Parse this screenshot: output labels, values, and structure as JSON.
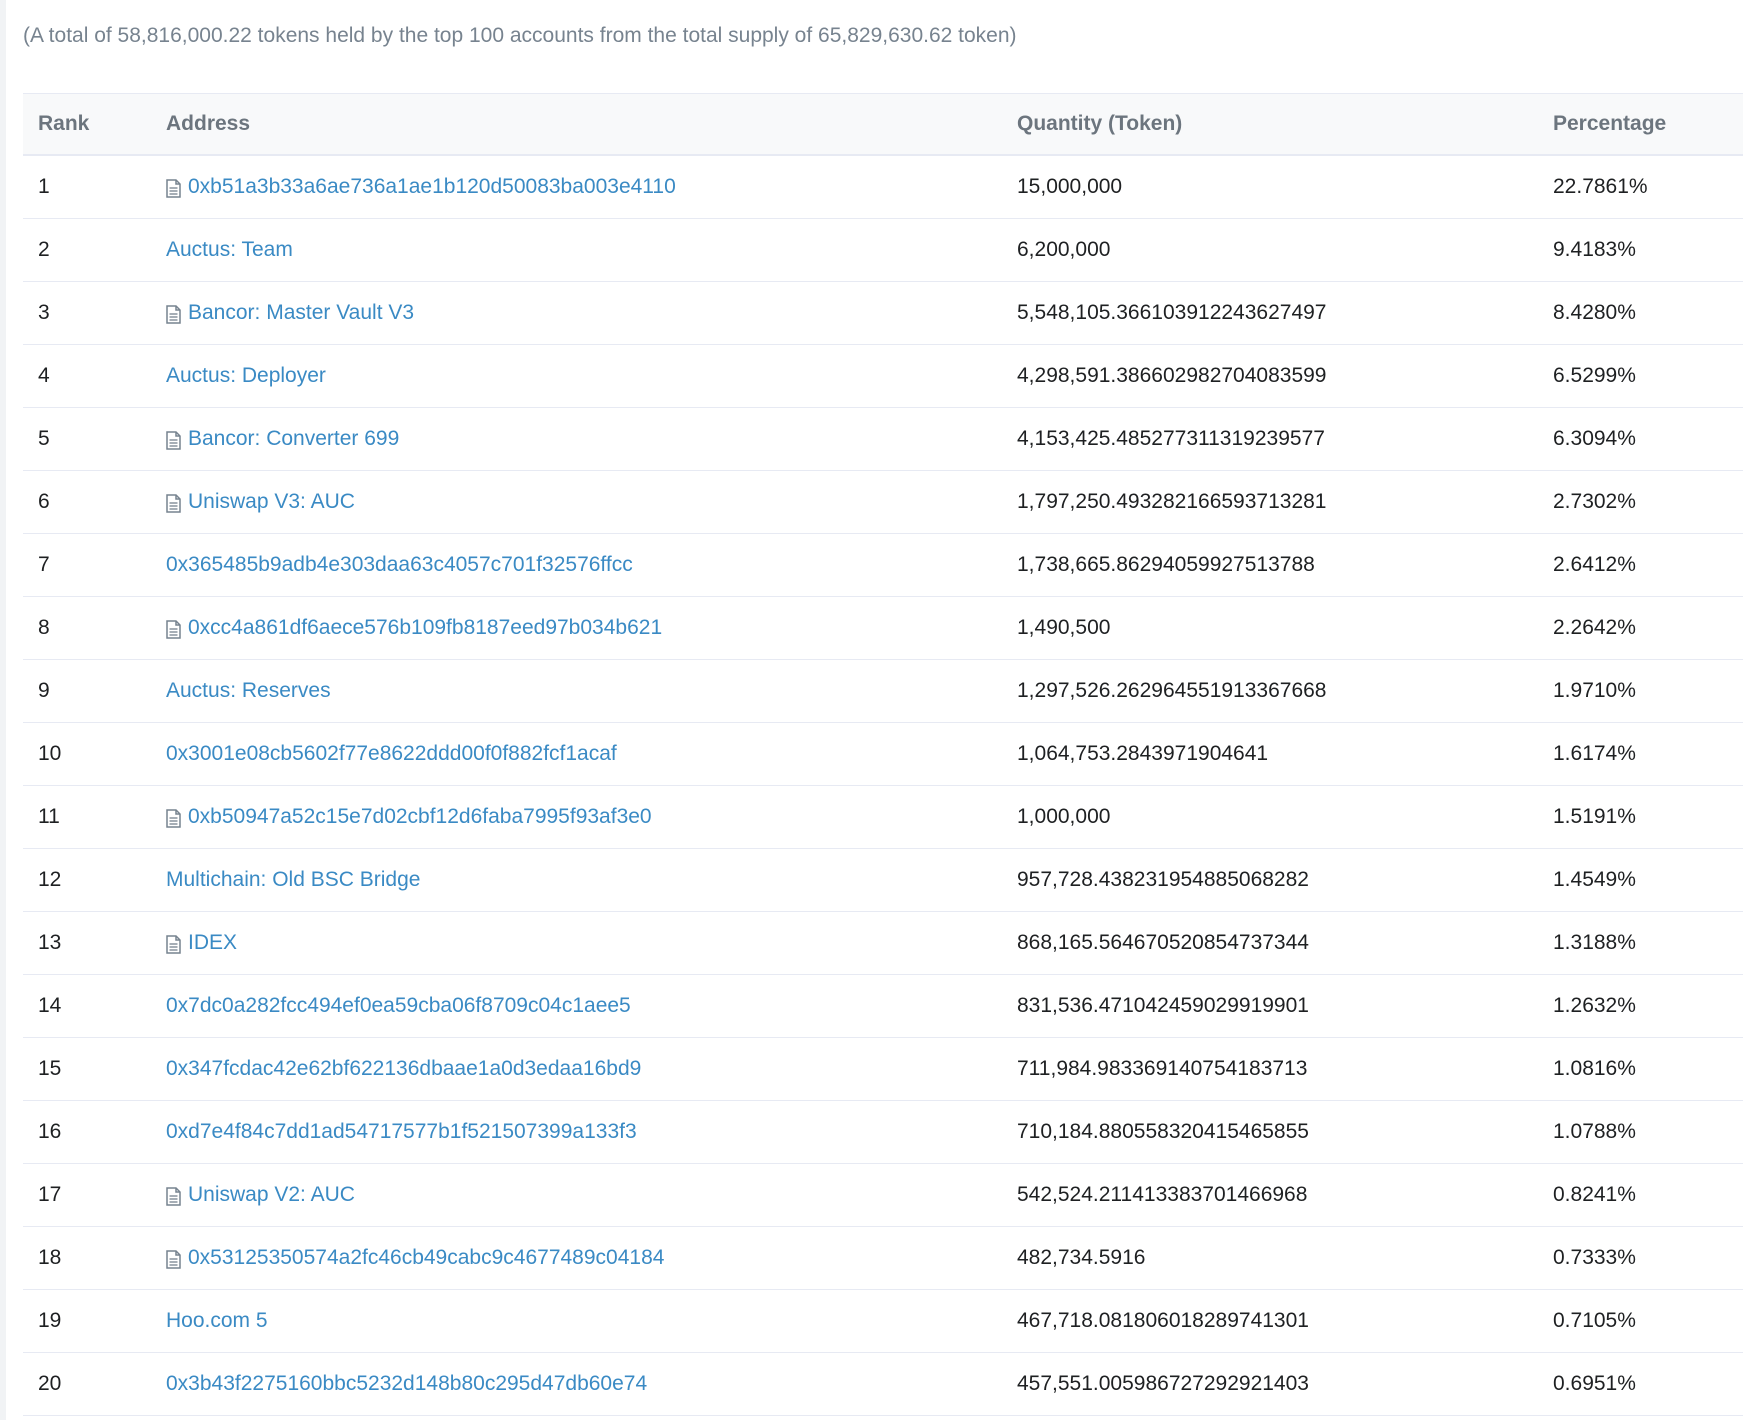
{
  "summary": "(A total of 58,816,000.22 tokens held by the top 100 accounts from the total supply of 65,829,630.62 token)",
  "table": {
    "headers": {
      "rank": "Rank",
      "address": "Address",
      "quantity": "Quantity (Token)",
      "percentage": "Percentage"
    },
    "rows": [
      {
        "rank": "1",
        "address": "0xb51a3b33a6ae736a1ae1b120d50083ba003e4110",
        "is_contract": true,
        "quantity": "15,000,000",
        "percentage": "22.7861%"
      },
      {
        "rank": "2",
        "address": "Auctus: Team",
        "is_contract": false,
        "quantity": "6,200,000",
        "percentage": "9.4183%"
      },
      {
        "rank": "3",
        "address": "Bancor: Master Vault V3",
        "is_contract": true,
        "quantity": "5,548,105.366103912243627497",
        "percentage": "8.4280%"
      },
      {
        "rank": "4",
        "address": "Auctus: Deployer",
        "is_contract": false,
        "quantity": "4,298,591.386602982704083599",
        "percentage": "6.5299%"
      },
      {
        "rank": "5",
        "address": "Bancor: Converter 699",
        "is_contract": true,
        "quantity": "4,153,425.485277311319239577",
        "percentage": "6.3094%"
      },
      {
        "rank": "6",
        "address": "Uniswap V3: AUC",
        "is_contract": true,
        "quantity": "1,797,250.493282166593713281",
        "percentage": "2.7302%"
      },
      {
        "rank": "7",
        "address": "0x365485b9adb4e303daa63c4057c701f32576ffcc",
        "is_contract": false,
        "quantity": "1,738,665.86294059927513788",
        "percentage": "2.6412%"
      },
      {
        "rank": "8",
        "address": "0xcc4a861df6aece576b109fb8187eed97b034b621",
        "is_contract": true,
        "quantity": "1,490,500",
        "percentage": "2.2642%"
      },
      {
        "rank": "9",
        "address": "Auctus: Reserves",
        "is_contract": false,
        "quantity": "1,297,526.262964551913367668",
        "percentage": "1.9710%"
      },
      {
        "rank": "10",
        "address": "0x3001e08cb5602f77e8622ddd00f0f882fcf1acaf",
        "is_contract": false,
        "quantity": "1,064,753.2843971904641",
        "percentage": "1.6174%"
      },
      {
        "rank": "11",
        "address": "0xb50947a52c15e7d02cbf12d6faba7995f93af3e0",
        "is_contract": true,
        "quantity": "1,000,000",
        "percentage": "1.5191%"
      },
      {
        "rank": "12",
        "address": "Multichain: Old BSC Bridge",
        "is_contract": false,
        "quantity": "957,728.438231954885068282",
        "percentage": "1.4549%"
      },
      {
        "rank": "13",
        "address": "IDEX",
        "is_contract": true,
        "quantity": "868,165.564670520854737344",
        "percentage": "1.3188%"
      },
      {
        "rank": "14",
        "address": "0x7dc0a282fcc494ef0ea59cba06f8709c04c1aee5",
        "is_contract": false,
        "quantity": "831,536.471042459029919901",
        "percentage": "1.2632%"
      },
      {
        "rank": "15",
        "address": "0x347fcdac42e62bf622136dbaae1a0d3edaa16bd9",
        "is_contract": false,
        "quantity": "711,984.983369140754183713",
        "percentage": "1.0816%"
      },
      {
        "rank": "16",
        "address": "0xd7e4f84c7dd1ad54717577b1f521507399a133f3",
        "is_contract": false,
        "quantity": "710,184.880558320415465855",
        "percentage": "1.0788%"
      },
      {
        "rank": "17",
        "address": "Uniswap V2: AUC",
        "is_contract": true,
        "quantity": "542,524.211413383701466968",
        "percentage": "0.8241%"
      },
      {
        "rank": "18",
        "address": "0x53125350574a2fc46cb49cabc9c4677489c04184",
        "is_contract": true,
        "quantity": "482,734.5916",
        "percentage": "0.7333%"
      },
      {
        "rank": "19",
        "address": "Hoo.com 5",
        "is_contract": false,
        "quantity": "467,718.081806018289741301",
        "percentage": "0.7105%"
      },
      {
        "rank": "20",
        "address": "0x3b43f2275160bbc5232d148b80c295d47db60e74",
        "is_contract": false,
        "quantity": "457,551.005986727292921403",
        "percentage": "0.6951%"
      }
    ]
  },
  "icons": {
    "contract": "contract-document-icon"
  },
  "colors": {
    "link": "#3a8ac4",
    "muted": "#77838f",
    "header_text": "#6c757e",
    "border": "#e7eaf3"
  }
}
